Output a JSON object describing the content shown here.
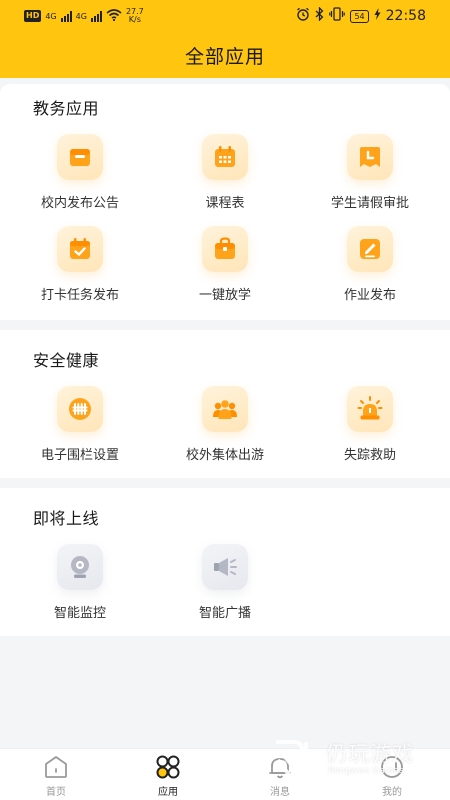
{
  "status_bar": {
    "net_badge": "HD",
    "signal1": "4G",
    "signal2": "4G",
    "speed_value": "27.7",
    "speed_unit": "K/s",
    "battery": "54",
    "time": "22:58"
  },
  "header": {
    "title": "全部应用"
  },
  "sections": [
    {
      "title": "教务应用",
      "apps": [
        {
          "label": "校内发布公告",
          "icon": "announcement-icon"
        },
        {
          "label": "课程表",
          "icon": "timetable-icon"
        },
        {
          "label": "学生请假审批",
          "icon": "leave-approval-icon"
        },
        {
          "label": "打卡任务发布",
          "icon": "checkin-task-icon"
        },
        {
          "label": "一键放学",
          "icon": "dismissal-bag-icon"
        },
        {
          "label": "作业发布",
          "icon": "homework-icon"
        }
      ]
    },
    {
      "title": "安全健康",
      "apps": [
        {
          "label": "电子围栏设置",
          "icon": "geofence-icon"
        },
        {
          "label": "校外集体出游",
          "icon": "group-outing-icon"
        },
        {
          "label": "失踪救助",
          "icon": "alarm-light-icon"
        }
      ]
    },
    {
      "title": "即将上线",
      "apps": [
        {
          "label": "智能监控",
          "icon": "camera-icon"
        },
        {
          "label": "智能广播",
          "icon": "speaker-icon"
        }
      ]
    }
  ],
  "bottom_nav": [
    {
      "label": "首页",
      "icon": "home-icon",
      "active": false
    },
    {
      "label": "应用",
      "icon": "apps-icon",
      "active": true
    },
    {
      "label": "消息",
      "icon": "bell-icon",
      "active": false
    },
    {
      "label": "我的",
      "icon": "profile-icon",
      "active": false
    }
  ],
  "watermark": {
    "text": "仍玩游戏",
    "sub": "Rengwan Games"
  },
  "colors": {
    "brand": "#ffc50f",
    "icon_orange": "#ffa41a",
    "icon_grey": "#b4b8c4"
  }
}
